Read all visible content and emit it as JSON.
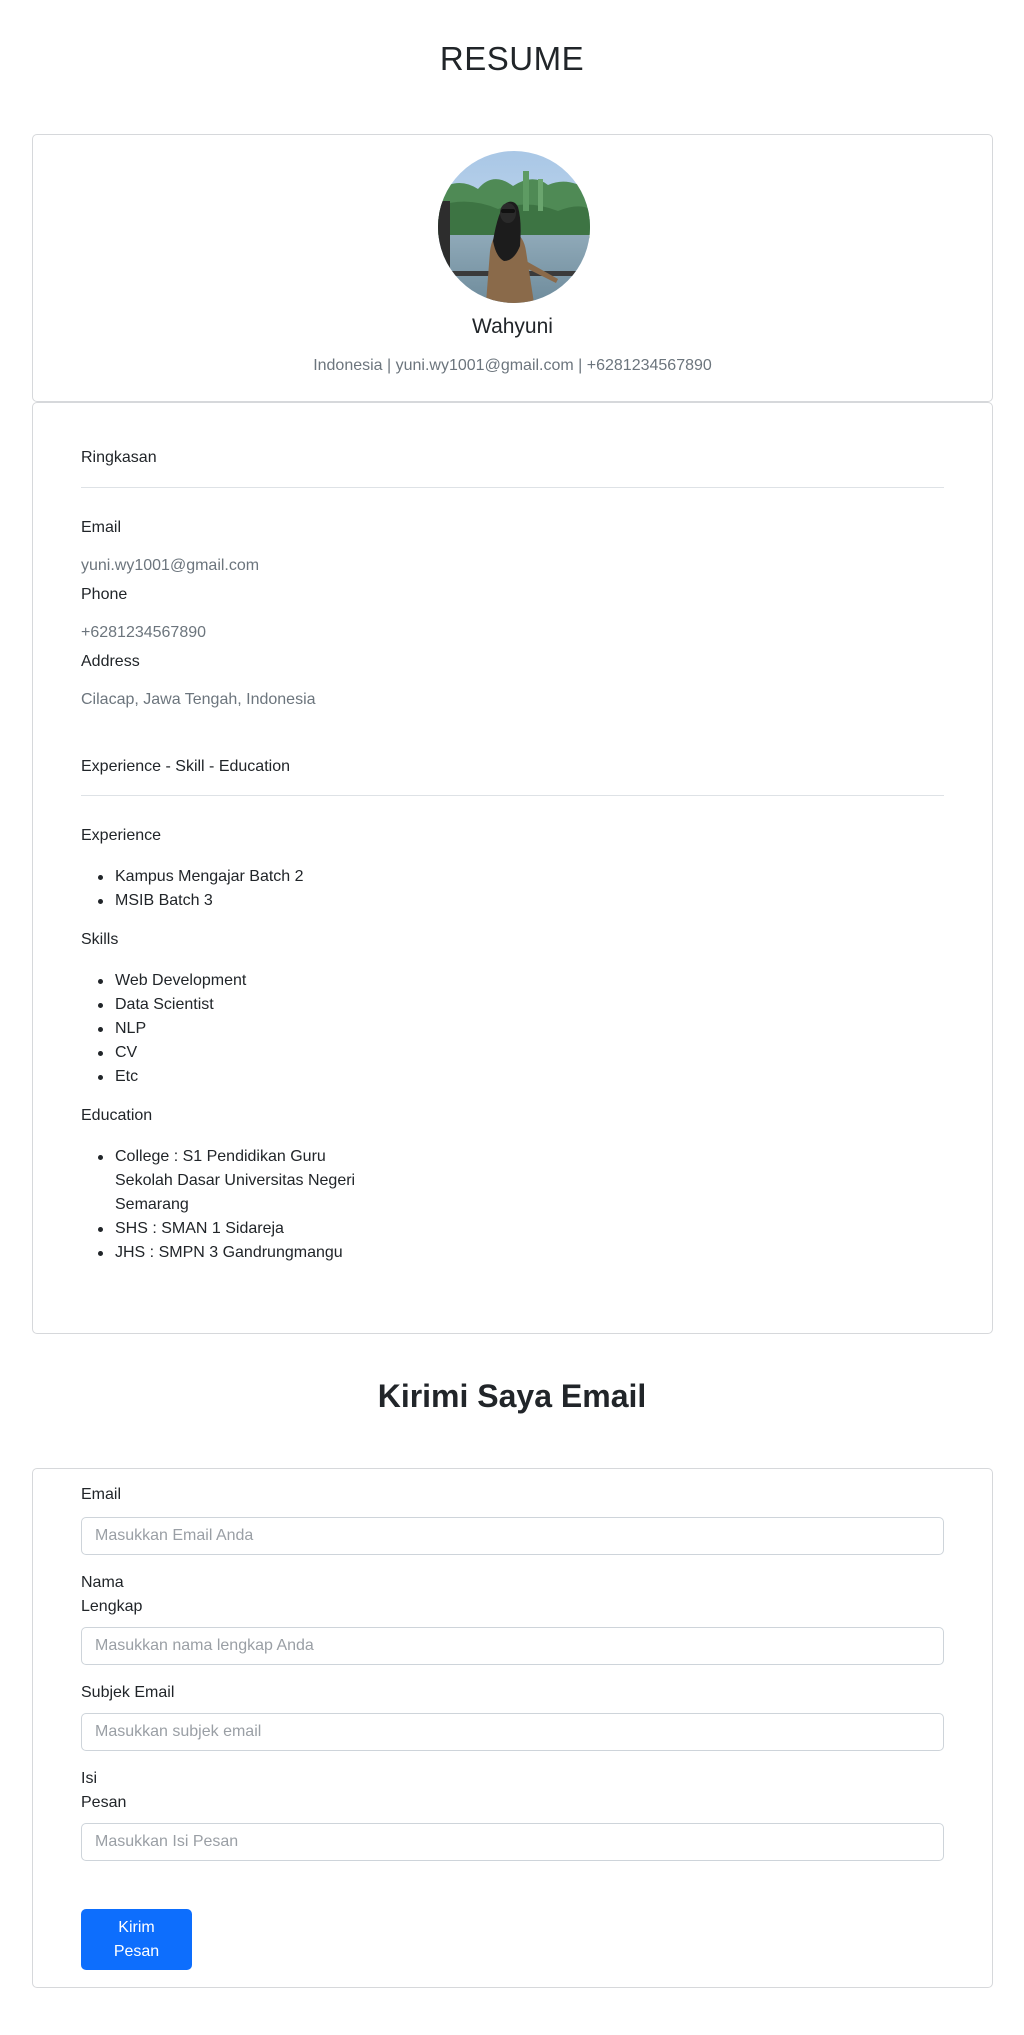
{
  "header": {
    "title": "RESUME"
  },
  "profile": {
    "name": "Wahyuni",
    "contact_line": "Indonesia | yuni.wy1001@gmail.com | +6281234567890"
  },
  "summary": {
    "heading": "Ringkasan",
    "email_label": "Email",
    "email_value": "yuni.wy1001@gmail.com",
    "phone_label": "Phone",
    "phone_value": "+6281234567890",
    "address_label": "Address",
    "address_value": "Cilacap, Jawa Tengah, Indonesia"
  },
  "details": {
    "heading": "Experience - Skill - Education",
    "experience_label": "Experience",
    "experience": [
      "Kampus Mengajar Batch 2",
      "MSIB Batch 3"
    ],
    "skills_label": "Skills",
    "skills": [
      "Web Development",
      "Data Scientist",
      "NLP",
      "CV",
      "Etc"
    ],
    "education_label": "Education",
    "education": [
      "College : S1 Pendidikan Guru Sekolah Dasar Universitas Negeri Semarang",
      "SHS : SMAN 1 Sidareja",
      "JHS : SMPN 3 Gandrungmangu"
    ]
  },
  "contact_form": {
    "title": "Kirimi Saya Email",
    "email_label": "Email",
    "email_placeholder": "Masukkan Email Anda",
    "name_label": "Nama Lengkap",
    "name_placeholder": "Masukkan nama lengkap Anda",
    "subject_label": "Subjek Email",
    "subject_placeholder": "Masukkan subjek email",
    "message_label": "Isi Pesan",
    "message_placeholder": "Masukkan Isi Pesan",
    "submit_label": "Kirim Pesan"
  },
  "colors": {
    "primary": "#0d6efd",
    "muted_text": "#6c757d",
    "border": "#d6d8db"
  }
}
